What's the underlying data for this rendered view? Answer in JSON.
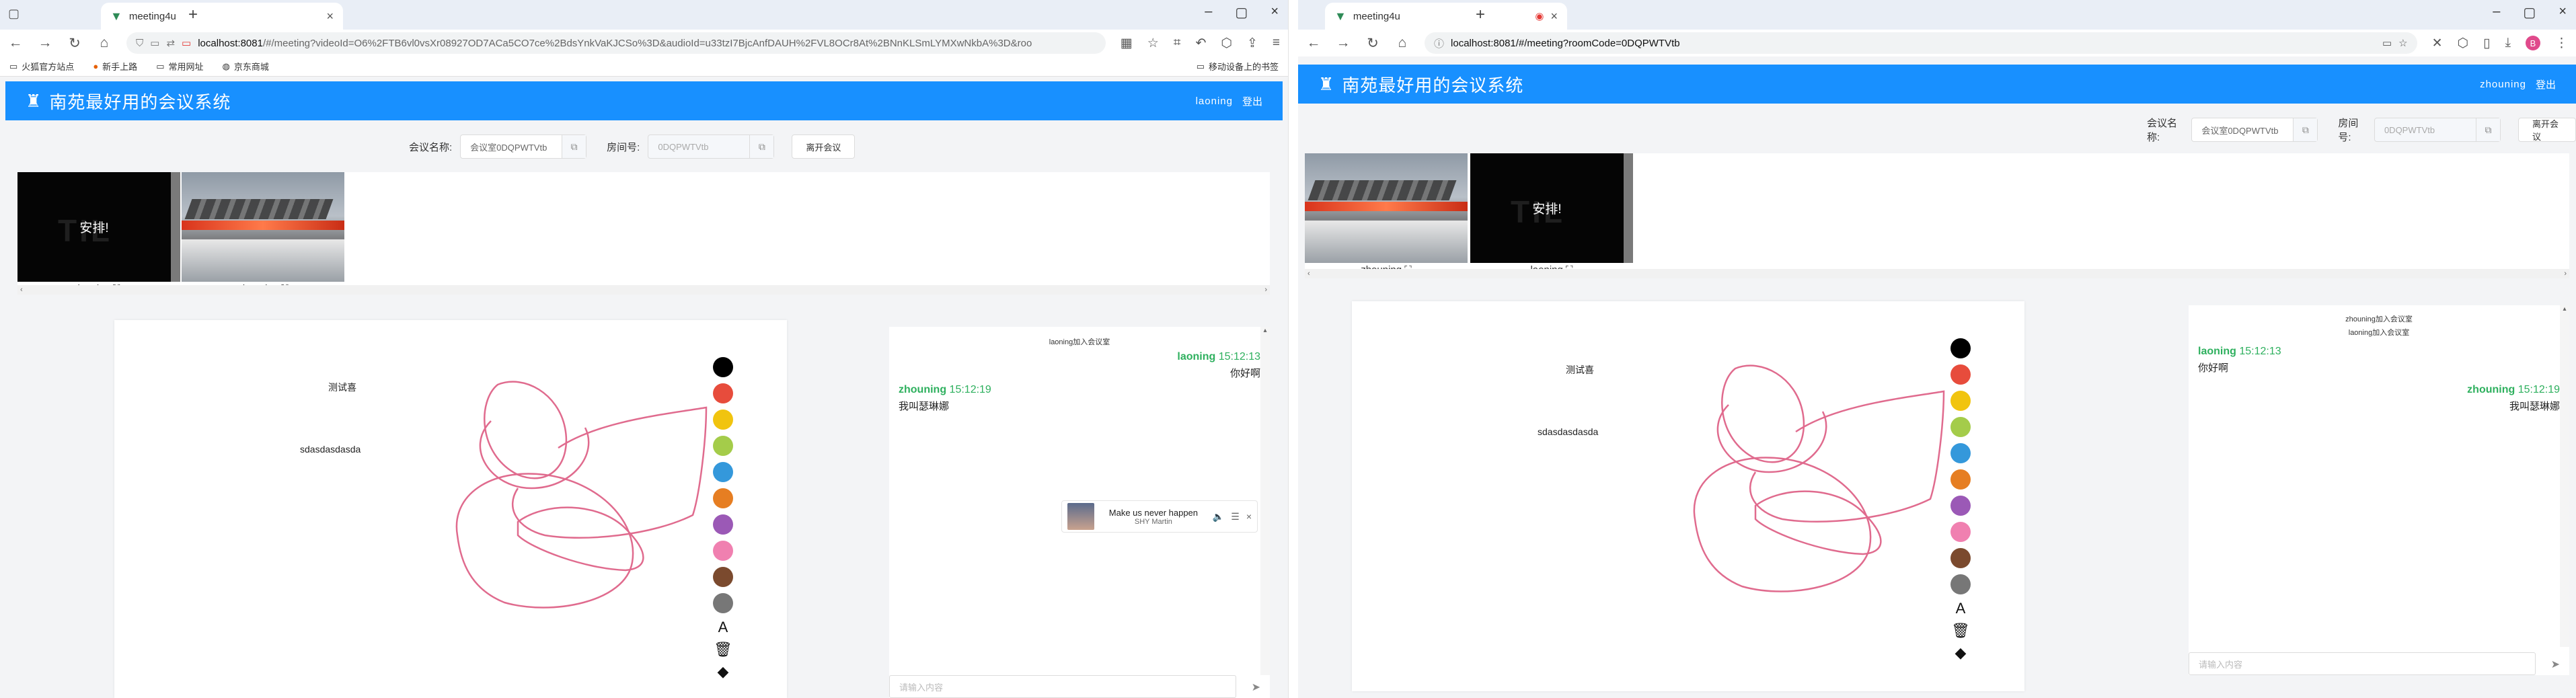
{
  "left": {
    "browser": {
      "tab_title": "meeting4u",
      "url_host": "localhost:8081",
      "url_rest": "/#/meeting?videoId=O6%2FTB6vl0vsXr08927OD7ACa5CO7ce%2BdsYnkVaKJCSo%3D&audioId=u33tzI7BjcAnfDAUH%2FVL8OCr8At%2BNnKLSmLYMXwNkbA%3D&roo",
      "bookmarks": [
        "火狐官方站点",
        "新手上路",
        "常用网址",
        "京东商城"
      ],
      "mobile_bookmarks": "移动设备上的书签"
    },
    "app": {
      "title": "南苑最好用的会议系统",
      "user": "laoning",
      "logout": "登出"
    },
    "toolbar": {
      "meeting_name_label": "会议名称:",
      "meeting_name_value": "会议室0DQPWTVtb",
      "room_label": "房间号:",
      "room_value": "0DQPWTVtb",
      "leave_button": "离开会议"
    },
    "videos": [
      {
        "name": "laoning",
        "overlay": "安排!",
        "ghost": "TIL"
      },
      {
        "name": "zhouning"
      }
    ],
    "board_texts": [
      "测试喜",
      "sdasdasdasda"
    ],
    "chat": {
      "system": [
        "laoning加入会议室"
      ],
      "messages": [
        {
          "who": "laoning",
          "time": "15:12:13",
          "text": "你好啊",
          "mine": true
        },
        {
          "who": "zhouning",
          "time": "15:12:19",
          "text": "我叫瑟琳娜",
          "mine": false
        }
      ],
      "input_placeholder": "请输入内容"
    },
    "music": {
      "song": "Make us never happen",
      "artist": "SHY Martin"
    }
  },
  "right": {
    "browser": {
      "tab_title": "meeting4u",
      "url": "localhost:8081/#/meeting?roomCode=0DQPWTVtb"
    },
    "app": {
      "title": "南苑最好用的会议系统",
      "user": "zhouning",
      "logout": "登出"
    },
    "toolbar": {
      "meeting_name_label": "会议名称:",
      "meeting_name_value": "会议室0DQPWTVtb",
      "room_label": "房间号:",
      "room_value": "0DQPWTVtb",
      "leave_button": "离开会议"
    },
    "videos": [
      {
        "name": "zhouning"
      },
      {
        "name": "laoning",
        "overlay": "安排!",
        "ghost": "TIL"
      }
    ],
    "board_texts": [
      "测试喜",
      "sdasdasdasda"
    ],
    "chat": {
      "system": [
        "zhouning加入会议室",
        "laoning加入会议室"
      ],
      "messages": [
        {
          "who": "laoning",
          "time": "15:12:13",
          "text": "你好啊",
          "mine": false
        },
        {
          "who": "zhouning",
          "time": "15:12:19",
          "text": "我叫瑟琳娜",
          "mine": true
        }
      ],
      "input_placeholder": "请输入内容"
    }
  },
  "palette_colors": [
    "#000000",
    "#e74c3c",
    "#f1c40f",
    "#a4cc4a",
    "#3498db",
    "#e67e22",
    "#9b59b6",
    "#f080b0",
    "#7b4a2e",
    "#777777"
  ],
  "stroke_color": "#e06b8e",
  "accent": "#1890ff",
  "palette_tools": [
    "text-tool-icon",
    "trash-icon",
    "eraser-icon"
  ]
}
